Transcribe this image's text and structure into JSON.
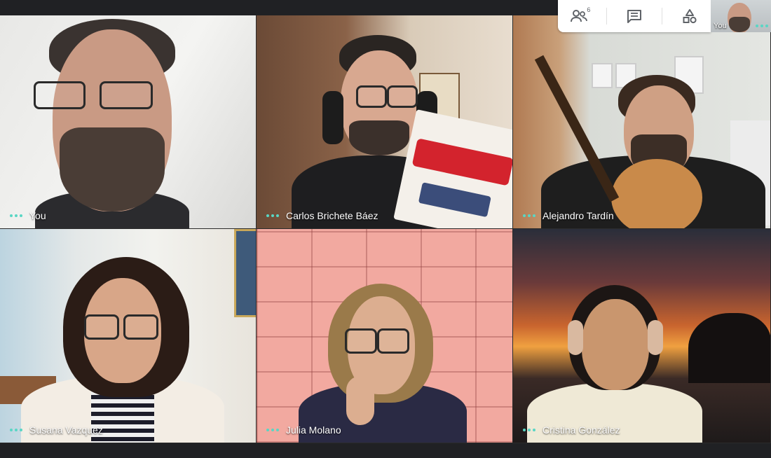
{
  "controls": {
    "participants_count": "6",
    "icons": [
      "people-icon",
      "chat-icon",
      "activities-icon"
    ]
  },
  "self_view": {
    "label": "You"
  },
  "participants": [
    {
      "name": "You"
    },
    {
      "name": "Carlos Brichete Báez"
    },
    {
      "name": "Alejandro Tardín"
    },
    {
      "name": "Susana Vazquez"
    },
    {
      "name": "Julia Molano"
    },
    {
      "name": "Cristina González"
    }
  ],
  "colors": {
    "top_bar": "#202124",
    "tile_dots": "#59d6c4",
    "panel_bg": "#ffffff"
  }
}
